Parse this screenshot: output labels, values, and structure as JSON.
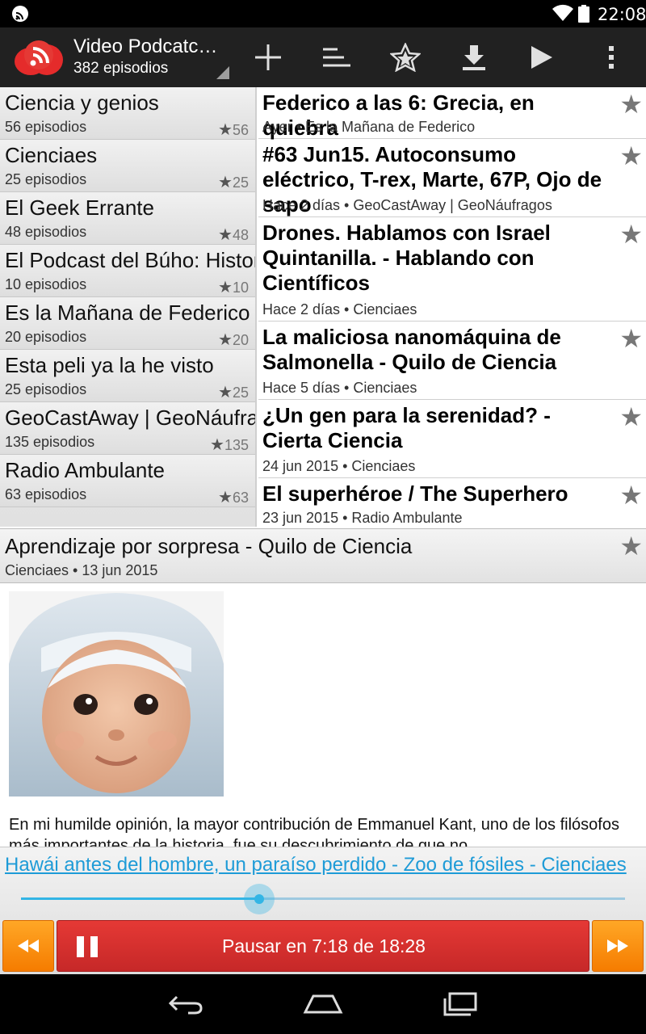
{
  "status": {
    "time": "22:08"
  },
  "header": {
    "title": "Video Podcatc…",
    "subtitle": "382 episodios",
    "actions": [
      "add-icon",
      "sort-icon",
      "favorites-icon",
      "download-icon",
      "play-icon",
      "overflow-menu-icon"
    ]
  },
  "podcasts": [
    {
      "name": "Ciencia y genios",
      "count": "56 episodios",
      "stars": "56"
    },
    {
      "name": "Cienciaes",
      "count": "25 episodios",
      "stars": "25"
    },
    {
      "name": "El Geek Errante",
      "count": "48 episodios",
      "stars": "48"
    },
    {
      "name": "El Podcast del Búho: Historia",
      "count": "10 episodios",
      "stars": "10"
    },
    {
      "name": "Es la Mañana de Federico",
      "count": "20 episodios",
      "stars": "20"
    },
    {
      "name": "Esta peli ya la he visto",
      "count": "25 episodios",
      "stars": "25"
    },
    {
      "name": "GeoCastAway | GeoNáufragos",
      "count": "135 episodios",
      "stars": "135"
    },
    {
      "name": "Radio Ambulante",
      "count": "63 episodios",
      "stars": "63"
    }
  ],
  "episodes": [
    {
      "title": "Federico a las 6: Grecia, en quiebra",
      "meta": "Ayer • Es la Mañana de Federico"
    },
    {
      "title": "#63 Jun15. Autoconsumo eléctrico, T-rex, Marte, 67P, Ojo de sapo",
      "meta": "Hace 2 días • GeoCastAway | GeoNáufragos"
    },
    {
      "title": "Drones. Hablamos con Israel Quintanilla. - Hablando con Científicos",
      "meta": "Hace 2 días • Cienciaes"
    },
    {
      "title": "La maliciosa nanomáquina de Salmonella - Quilo de Ciencia",
      "meta": "Hace 5 días • Cienciaes"
    },
    {
      "title": "¿Un gen para la serenidad? - Cierta Ciencia",
      "meta": "24 jun 2015 • Cienciaes"
    },
    {
      "title": "El superhéroe / The Superhero",
      "meta": "23 jun 2015 • Radio Ambulante"
    }
  ],
  "current": {
    "title": "Aprendizaje por sorpresa - Quilo de Ciencia",
    "meta": "Cienciaes • 13 jun 2015",
    "description": "En mi humilde opinión, la mayor contribución de Emmanuel Kant, uno de los filósofos más importantes de la historia, fue su descubrimiento de que no"
  },
  "player": {
    "now_playing": "Hawái antes del hombre, un paraíso perdido - Zoo de fósiles - Cienciaes",
    "progress": 0.395,
    "pause_label": "Pausar en 7:18 de 18:28"
  },
  "colors": {
    "accent": "#33b5e5",
    "play": "#d32f2f",
    "seek": "#ff9800"
  }
}
